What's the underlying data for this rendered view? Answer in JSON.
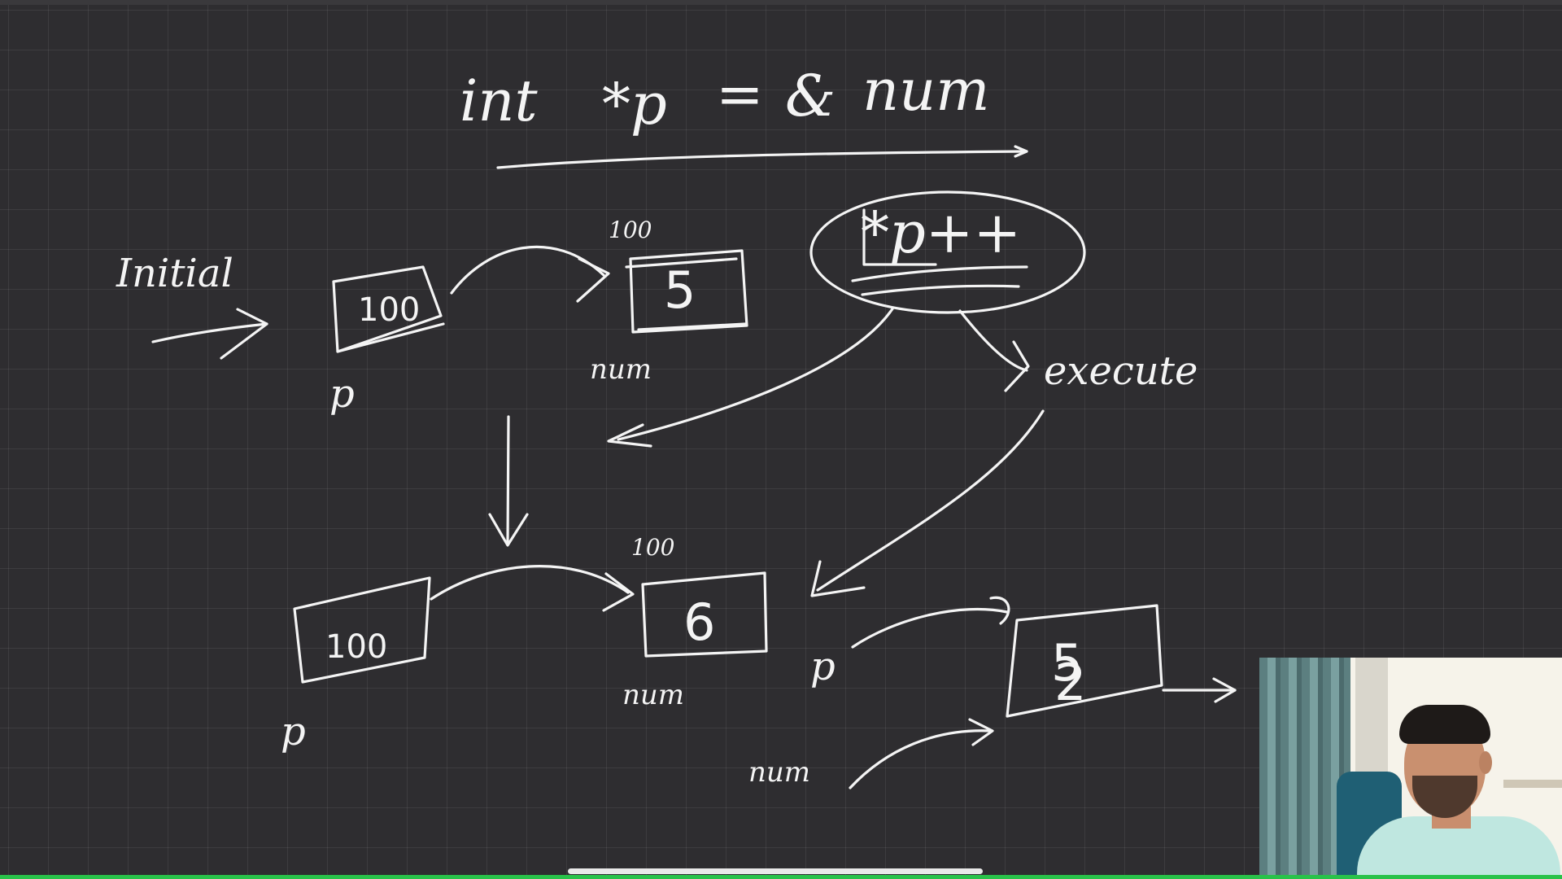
{
  "board": {
    "declaration": {
      "keyword": "int",
      "pointer": "*p",
      "equals": "=",
      "address_of": "&",
      "variable": "num"
    },
    "initial_label": "Initial",
    "expression": "*p++",
    "execute_label": "execute",
    "diagram_initial": {
      "pointer_box_value": "100",
      "pointer_name": "p",
      "target_address": "100",
      "target_value": "5",
      "target_name": "num"
    },
    "diagram_after_increment": {
      "pointer_box_value": "100",
      "pointer_name": "p",
      "target_address": "100",
      "target_value": "6",
      "target_name": "num"
    },
    "diagram_after_execute": {
      "pointer_name": "p",
      "target_value_overwritten": "5",
      "target_value_new": "2",
      "target_name": "num"
    }
  },
  "ui": {
    "webcam_label": "presenter webcam",
    "accent_color": "#29c24a",
    "ink_color": "#f4f4f4",
    "board_color": "#2e2d30"
  }
}
